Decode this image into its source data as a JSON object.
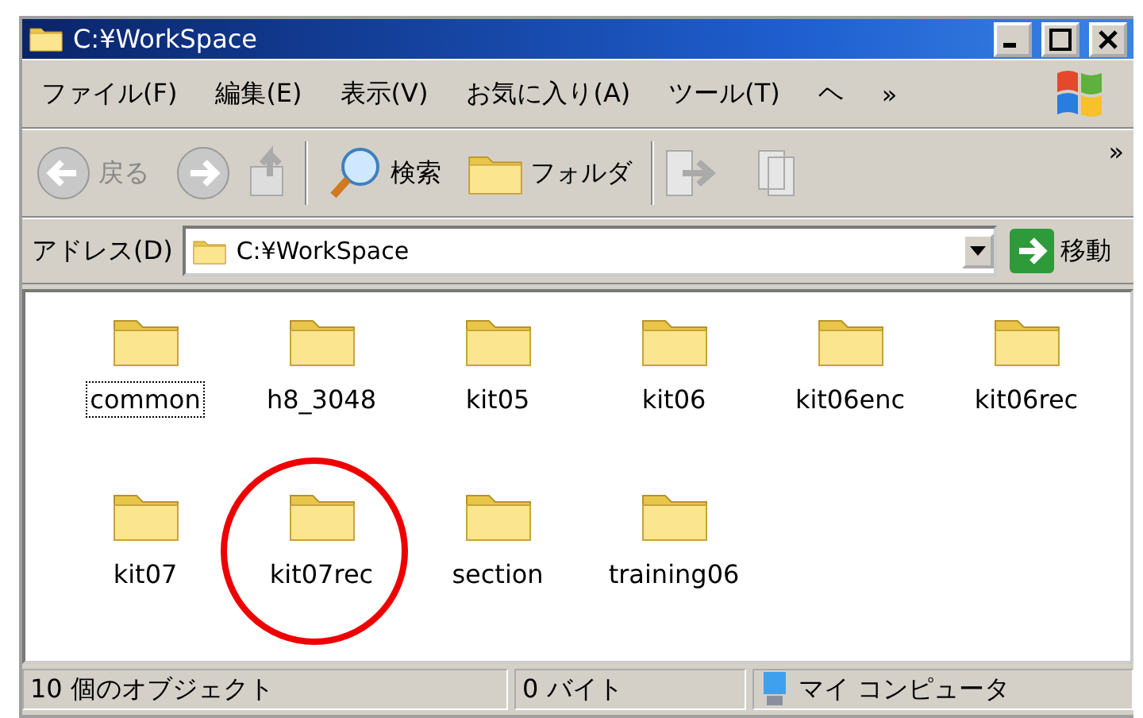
{
  "window": {
    "title": "C:¥WorkSpace"
  },
  "menu": [
    "ファイル(F)",
    "編集(E)",
    "表示(V)",
    "お気に入り(A)",
    "ツール(T)",
    "ヘ",
    "»"
  ],
  "toolbar": {
    "back": "戻る",
    "search": "検索",
    "folders": "フォルダ",
    "more": "»"
  },
  "address": {
    "label": "アドレス(D)",
    "value": "C:¥WorkSpace",
    "go": "移動"
  },
  "items": [
    {
      "name": "common",
      "focused": true,
      "circled": false
    },
    {
      "name": "h8_3048",
      "focused": false,
      "circled": false
    },
    {
      "name": "kit05",
      "focused": false,
      "circled": false
    },
    {
      "name": "kit06",
      "focused": false,
      "circled": false
    },
    {
      "name": "kit06enc",
      "focused": false,
      "circled": false
    },
    {
      "name": "kit06rec",
      "focused": false,
      "circled": false
    },
    {
      "name": "kit07",
      "focused": false,
      "circled": false
    },
    {
      "name": "kit07rec",
      "focused": false,
      "circled": true
    },
    {
      "name": "section",
      "focused": false,
      "circled": false
    },
    {
      "name": "training06",
      "focused": false,
      "circled": false
    }
  ],
  "status_bar": {
    "objects": "10 個のオブジェクト",
    "size": "0 バイト",
    "zone": "マイ コンピュータ"
  }
}
